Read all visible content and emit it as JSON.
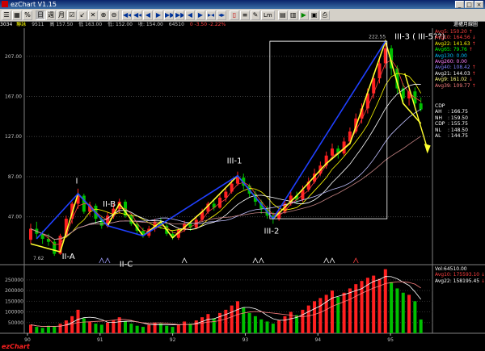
{
  "window": {
    "title": "ezChart V1.15",
    "controls": [
      "_",
      "□",
      "×"
    ]
  },
  "toolbar": {
    "buttons": [
      {
        "name": "list-icon",
        "glyph": "☰",
        "tone": ""
      },
      {
        "name": "grid-icon",
        "glyph": "▦",
        "tone": ""
      },
      {
        "name": "percent-icon",
        "glyph": "%",
        "tone": ""
      },
      {
        "name": "day-chart-icon",
        "glyph": "日",
        "tone": "",
        "pressed": true
      },
      {
        "name": "week-chart-icon",
        "glyph": "週",
        "tone": ""
      },
      {
        "name": "month-chart-icon",
        "glyph": "月",
        "tone": ""
      },
      {
        "name": "checkbox-icon",
        "glyph": "☑",
        "tone": ""
      },
      {
        "name": "tick-icon",
        "glyph": "↙",
        "tone": ""
      },
      {
        "name": "cross-icon",
        "glyph": "✕",
        "tone": ""
      },
      {
        "name": "zoom-in-icon",
        "glyph": "⊕",
        "tone": ""
      },
      {
        "name": "zoom-out-icon",
        "glyph": "⊖",
        "tone": ""
      },
      {
        "name": "first-icon",
        "glyph": "◀◀",
        "tone": "blue"
      },
      {
        "name": "prev-page-icon",
        "glyph": "◀◀",
        "tone": "blue"
      },
      {
        "name": "prev-icon",
        "glyph": "◀",
        "tone": "blue"
      },
      {
        "name": "next-icon",
        "glyph": "▶",
        "tone": "blue"
      },
      {
        "name": "next-page-icon",
        "glyph": "▶▶",
        "tone": "blue"
      },
      {
        "name": "last-icon",
        "glyph": "▶▶",
        "tone": "blue"
      },
      {
        "name": "left-icon",
        "glyph": "◀",
        "tone": "blue"
      },
      {
        "name": "right-icon",
        "glyph": "▶",
        "tone": "blue"
      },
      {
        "name": "narrow-icon",
        "glyph": "▸◂",
        "tone": "blue"
      },
      {
        "name": "widen-icon",
        "glyph": "◂▸",
        "tone": "blue"
      },
      {
        "name": "candle-icon",
        "glyph": "▯",
        "tone": "red"
      },
      {
        "name": "line-icon",
        "glyph": "≡",
        "tone": ""
      },
      {
        "name": "pen-icon",
        "glyph": "✎",
        "tone": ""
      },
      {
        "name": "lm-button",
        "glyph": "Lm",
        "tone": "lbl"
      },
      {
        "name": "calendar-icon",
        "glyph": "▤",
        "tone": ""
      },
      {
        "name": "bars-icon",
        "glyph": "▥",
        "tone": ""
      },
      {
        "name": "play-icon",
        "glyph": "▶",
        "tone": "grn"
      },
      {
        "name": "save-icon",
        "glyph": "▣",
        "tone": ""
      },
      {
        "name": "print-icon",
        "glyph": "⎙",
        "tone": ""
      }
    ]
  },
  "quote": {
    "code": "3034",
    "name": "聯詠",
    "volume": "9511",
    "high": "高 157.50",
    "low": "低 163.00",
    "low2": "低: 152.00",
    "last": "收: 154.00",
    "vol2": "64510",
    "change": "0 -3.50 -2.22%",
    "period_label": "還權月線圖"
  },
  "indicators": [
    {
      "label": "Avg5:",
      "value": "150.20",
      "color": "#ff4040",
      "arrow": "↑"
    },
    {
      "label": "Avg10:",
      "value": "164.56",
      "color": "#ff4040",
      "arrow": "↓"
    },
    {
      "label": "Avg22:",
      "value": "141.63",
      "color": "#ffff00",
      "arrow": "↑"
    },
    {
      "label": "Avg65:",
      "value": "79.76",
      "color": "#00ff00",
      "arrow": "↑"
    },
    {
      "label": "Avg130:",
      "value": "0.00",
      "color": "#00c0ff",
      "arrow": ""
    },
    {
      "label": "Avg260:",
      "value": "0.00",
      "color": "#ff80ff",
      "arrow": ""
    },
    {
      "label": "Avg40:",
      "value": "108.42",
      "color": "#8080ff",
      "arrow": "↑"
    },
    {
      "label": "Avg21:",
      "value": "144.03",
      "color": "#ffffff",
      "arrow": "↑"
    },
    {
      "label": "Avg9:",
      "value": "161.02",
      "color": "#ffff80",
      "arrow": "↓"
    },
    {
      "label": "Avg39:",
      "value": "109.77",
      "color": "#ff8080",
      "arrow": "↑"
    }
  ],
  "cdp": {
    "title": "CDP",
    "rows": [
      {
        "label": "AH",
        "value": ": 166.75"
      },
      {
        "label": "NH",
        "value": ": 159.50"
      },
      {
        "label": "CDP",
        "value": ": 155.75"
      },
      {
        "label": "NL",
        "value": ": 148.50"
      },
      {
        "label": "AL",
        "value": ": 144.75"
      }
    ]
  },
  "volume_legend": [
    {
      "text": "Vol:64510.00",
      "color": "#ffffff"
    },
    {
      "text": "Avg10: 175593.10",
      "color": "#ff4040",
      "arrow": "↓"
    },
    {
      "text": "Avg22: 158195.45",
      "color": "#ffffff",
      "arrow": "↓"
    }
  ],
  "annotations": {
    "wave_I": "I",
    "wave_IIA": "II-A",
    "wave_IIB": "II-B",
    "wave_IIC": "II-C",
    "wave_III1": "III-1",
    "wave_III2": "III-2",
    "wave_III3": "III-3 ( III-5??)",
    "peak_label": "222.55",
    "low_label": "7.62"
  },
  "chart_data": {
    "type": "bar",
    "title": "",
    "price_axis": {
      "ticks": [
        207.0,
        167.0,
        127.0,
        87.0,
        47.0
      ]
    },
    "volume_axis": {
      "ticks": [
        250000,
        200000,
        150000,
        100000,
        50000
      ]
    },
    "x_ticks": [
      "90",
      "91",
      "92",
      "93",
      "94",
      "95"
    ],
    "candles_approx": [
      {
        "o": 24,
        "c": 35,
        "h": 40,
        "l": 20
      },
      {
        "o": 35,
        "c": 30,
        "h": 42,
        "l": 25
      },
      {
        "o": 30,
        "c": 25,
        "h": 33,
        "l": 20
      },
      {
        "o": 25,
        "c": 22,
        "h": 30,
        "l": 18
      },
      {
        "o": 22,
        "c": 10,
        "h": 24,
        "l": 8
      },
      {
        "o": 10,
        "c": 28,
        "h": 30,
        "l": 9
      },
      {
        "o": 28,
        "c": 45,
        "h": 48,
        "l": 26
      },
      {
        "o": 45,
        "c": 60,
        "h": 62,
        "l": 40
      },
      {
        "o": 60,
        "c": 68,
        "h": 75,
        "l": 55
      },
      {
        "o": 68,
        "c": 52,
        "h": 70,
        "l": 50
      },
      {
        "o": 52,
        "c": 58,
        "h": 62,
        "l": 48
      },
      {
        "o": 58,
        "c": 45,
        "h": 60,
        "l": 40
      },
      {
        "o": 45,
        "c": 38,
        "h": 48,
        "l": 35
      },
      {
        "o": 38,
        "c": 48,
        "h": 52,
        "l": 36
      },
      {
        "o": 48,
        "c": 55,
        "h": 60,
        "l": 45
      },
      {
        "o": 55,
        "c": 62,
        "h": 65,
        "l": 50
      },
      {
        "o": 62,
        "c": 48,
        "h": 64,
        "l": 46
      },
      {
        "o": 48,
        "c": 40,
        "h": 50,
        "l": 38
      },
      {
        "o": 40,
        "c": 33,
        "h": 42,
        "l": 30
      },
      {
        "o": 33,
        "c": 28,
        "h": 36,
        "l": 26
      },
      {
        "o": 28,
        "c": 35,
        "h": 38,
        "l": 26
      },
      {
        "o": 35,
        "c": 42,
        "h": 45,
        "l": 32
      },
      {
        "o": 42,
        "c": 38,
        "h": 46,
        "l": 35
      },
      {
        "o": 38,
        "c": 30,
        "h": 40,
        "l": 28
      },
      {
        "o": 30,
        "c": 26,
        "h": 33,
        "l": 24
      },
      {
        "o": 26,
        "c": 34,
        "h": 36,
        "l": 24
      },
      {
        "o": 34,
        "c": 40,
        "h": 43,
        "l": 32
      },
      {
        "o": 40,
        "c": 36,
        "h": 42,
        "l": 33
      },
      {
        "o": 36,
        "c": 44,
        "h": 48,
        "l": 35
      },
      {
        "o": 44,
        "c": 52,
        "h": 55,
        "l": 42
      },
      {
        "o": 52,
        "c": 60,
        "h": 62,
        "l": 50
      },
      {
        "o": 60,
        "c": 56,
        "h": 64,
        "l": 53
      },
      {
        "o": 56,
        "c": 66,
        "h": 70,
        "l": 55
      },
      {
        "o": 66,
        "c": 72,
        "h": 75,
        "l": 62
      },
      {
        "o": 72,
        "c": 80,
        "h": 84,
        "l": 70
      },
      {
        "o": 80,
        "c": 86,
        "h": 92,
        "l": 78
      },
      {
        "o": 86,
        "c": 78,
        "h": 90,
        "l": 74
      },
      {
        "o": 78,
        "c": 70,
        "h": 80,
        "l": 66
      },
      {
        "o": 70,
        "c": 62,
        "h": 73,
        "l": 58
      },
      {
        "o": 62,
        "c": 55,
        "h": 64,
        "l": 50
      },
      {
        "o": 55,
        "c": 48,
        "h": 58,
        "l": 45
      },
      {
        "o": 48,
        "c": 45,
        "h": 52,
        "l": 40
      },
      {
        "o": 45,
        "c": 52,
        "h": 56,
        "l": 43
      },
      {
        "o": 52,
        "c": 60,
        "h": 64,
        "l": 50
      },
      {
        "o": 60,
        "c": 68,
        "h": 72,
        "l": 58
      },
      {
        "o": 68,
        "c": 64,
        "h": 72,
        "l": 60
      },
      {
        "o": 64,
        "c": 74,
        "h": 78,
        "l": 62
      },
      {
        "o": 74,
        "c": 82,
        "h": 86,
        "l": 72
      },
      {
        "o": 82,
        "c": 90,
        "h": 95,
        "l": 80
      },
      {
        "o": 90,
        "c": 98,
        "h": 102,
        "l": 88
      },
      {
        "o": 98,
        "c": 108,
        "h": 112,
        "l": 95
      },
      {
        "o": 108,
        "c": 115,
        "h": 120,
        "l": 104
      },
      {
        "o": 115,
        "c": 110,
        "h": 118,
        "l": 105
      },
      {
        "o": 110,
        "c": 122,
        "h": 126,
        "l": 108
      },
      {
        "o": 122,
        "c": 132,
        "h": 136,
        "l": 120
      },
      {
        "o": 132,
        "c": 145,
        "h": 150,
        "l": 130
      },
      {
        "o": 145,
        "c": 155,
        "h": 160,
        "l": 140
      },
      {
        "o": 155,
        "c": 170,
        "h": 175,
        "l": 150
      },
      {
        "o": 170,
        "c": 185,
        "h": 190,
        "l": 165
      },
      {
        "o": 185,
        "c": 200,
        "h": 205,
        "l": 180
      },
      {
        "o": 200,
        "c": 215,
        "h": 222.55,
        "l": 195
      },
      {
        "o": 215,
        "c": 195,
        "h": 218,
        "l": 188
      },
      {
        "o": 195,
        "c": 175,
        "h": 198,
        "l": 170
      },
      {
        "o": 175,
        "c": 165,
        "h": 180,
        "l": 160
      },
      {
        "o": 165,
        "c": 172,
        "h": 178,
        "l": 158
      },
      {
        "o": 172,
        "c": 160,
        "h": 176,
        "l": 155
      },
      {
        "o": 160,
        "c": 154,
        "h": 166,
        "l": 152
      }
    ],
    "volumes_approx": [
      40000,
      30000,
      25000,
      35000,
      30000,
      45000,
      60000,
      80000,
      110000,
      70000,
      55000,
      45000,
      40000,
      50000,
      60000,
      75000,
      55000,
      45000,
      35000,
      30000,
      40000,
      50000,
      45000,
      35000,
      30000,
      40000,
      55000,
      45000,
      60000,
      75000,
      90000,
      70000,
      95000,
      110000,
      130000,
      150000,
      120000,
      95000,
      80000,
      65000,
      55000,
      45000,
      60000,
      80000,
      100000,
      85000,
      110000,
      130000,
      150000,
      165000,
      180000,
      200000,
      170000,
      190000,
      210000,
      230000,
      245000,
      260000,
      270000,
      255000,
      300000,
      240000,
      210000,
      190000,
      180000,
      150000,
      64510
    ]
  }
}
